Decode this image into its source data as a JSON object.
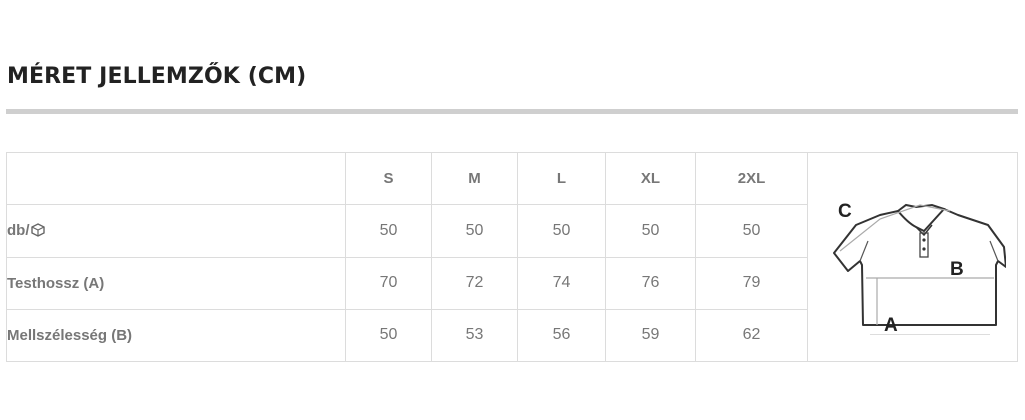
{
  "title": "MÉRET JELLEMZŐK (CM)",
  "table": {
    "headers": [
      "S",
      "M",
      "L",
      "XL",
      "2XL"
    ],
    "rows": [
      {
        "label": "db/",
        "icon": "box-icon",
        "values": [
          "50",
          "50",
          "50",
          "50",
          "50"
        ]
      },
      {
        "label": "Testhossz (A)",
        "values": [
          "70",
          "72",
          "74",
          "76",
          "79"
        ]
      },
      {
        "label": "Mellszélesség (B)",
        "values": [
          "50",
          "53",
          "56",
          "59",
          "62"
        ]
      }
    ]
  },
  "diagram": {
    "icon": "polo-shirt-icon",
    "labels": {
      "c": "C",
      "b": "B",
      "a": "A"
    }
  }
}
